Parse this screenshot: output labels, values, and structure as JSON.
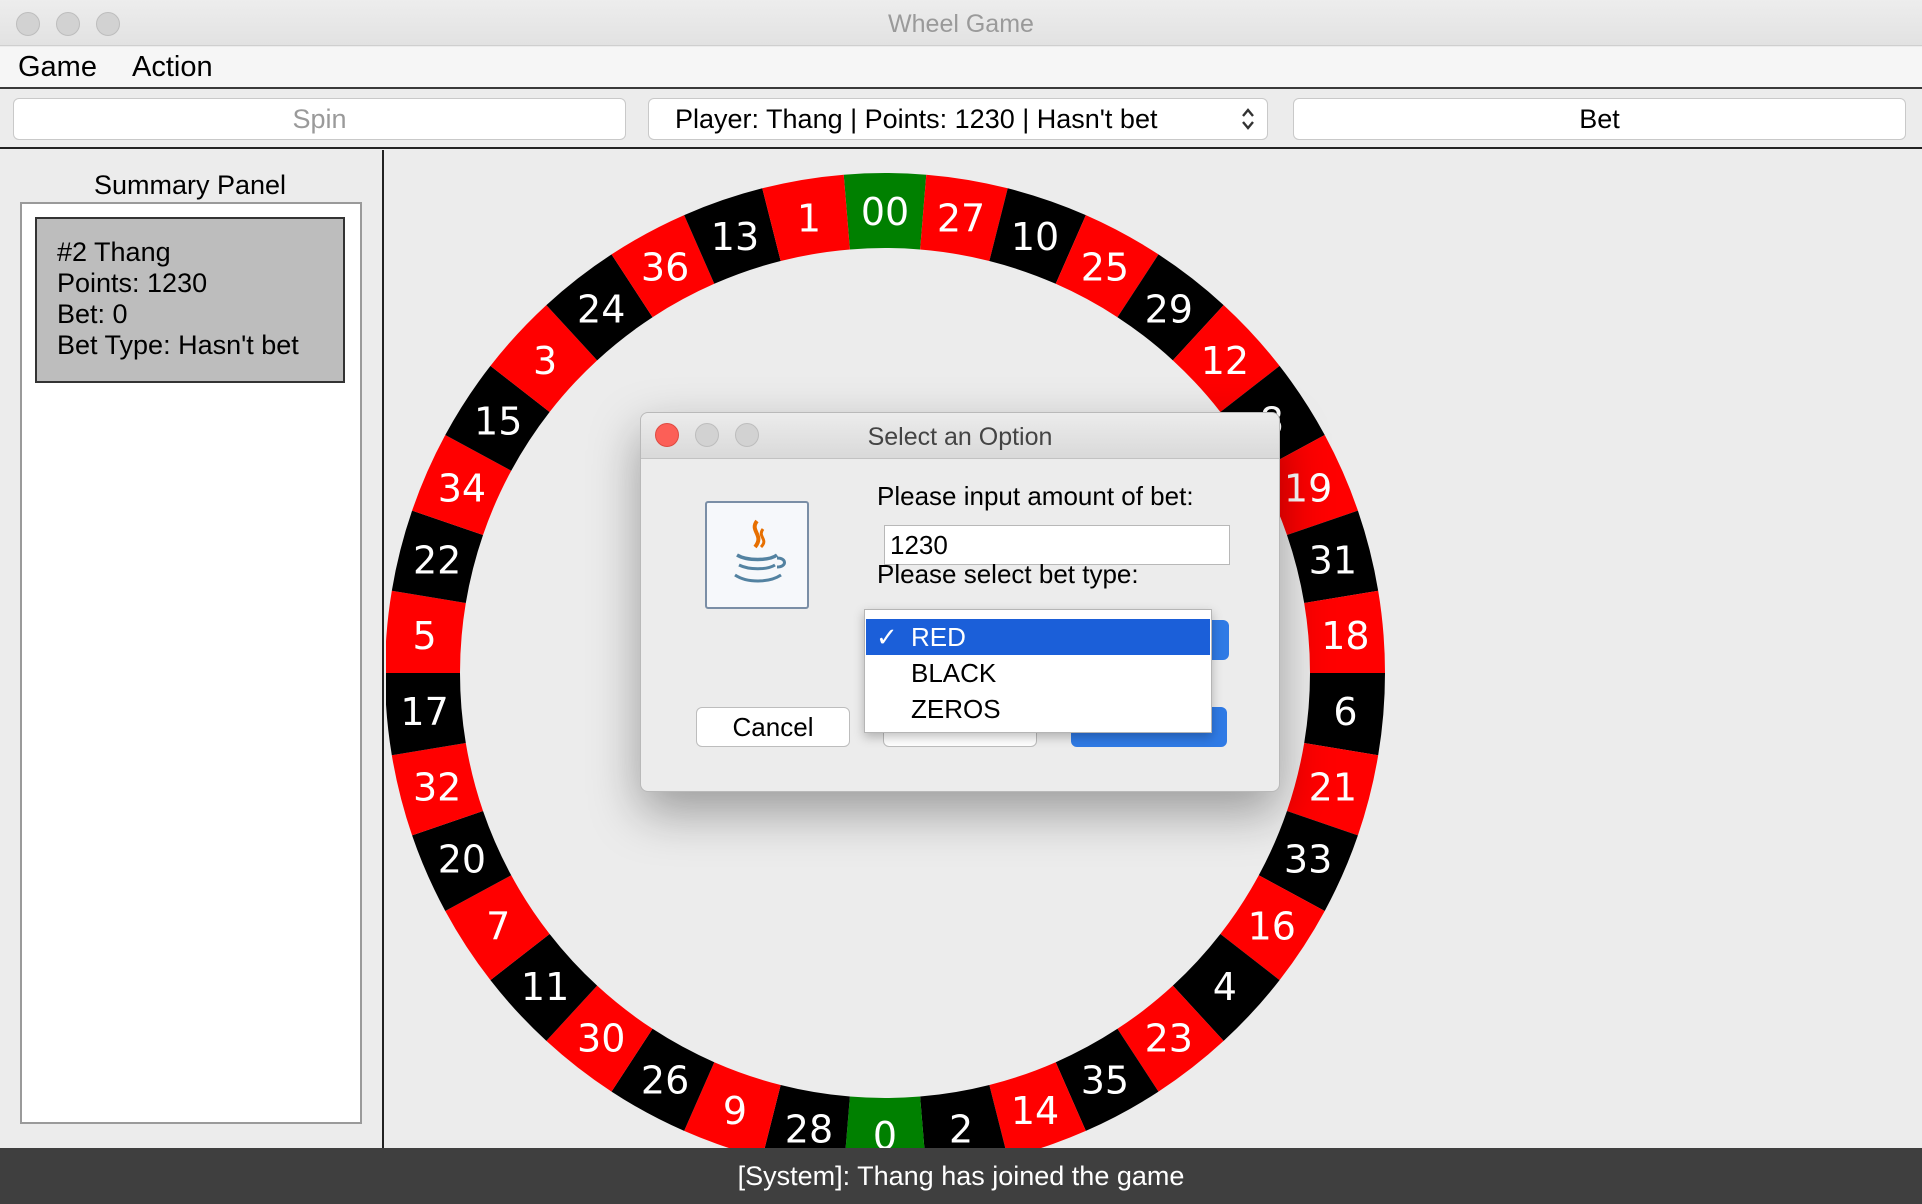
{
  "window": {
    "title": "Wheel Game"
  },
  "menubar": {
    "items": [
      "Game",
      "Action"
    ]
  },
  "toolbar": {
    "spin_label": "Spin",
    "player_select_value": "Player: Thang | Points: 1230 | Hasn't bet",
    "bet_label": "Bet"
  },
  "summary": {
    "title": "Summary Panel",
    "card": {
      "name": "#2 Thang",
      "points": "Points: 1230",
      "bet": "Bet: 0",
      "bet_type": "Bet Type: Hasn't bet"
    }
  },
  "wheel": {
    "numbers": [
      "00",
      "27",
      "10",
      "25",
      "29",
      "12",
      "8",
      "19",
      "31",
      "18",
      "6",
      "21",
      "33",
      "16",
      "4",
      "23",
      "35",
      "14",
      "2",
      "0",
      "28",
      "9",
      "26",
      "30",
      "11",
      "7",
      "20",
      "32",
      "17",
      "5",
      "22",
      "34",
      "15",
      "3",
      "24",
      "36",
      "13",
      "1"
    ],
    "colors": {
      "red": "#ff0000",
      "black": "#000000",
      "green": "#008000"
    },
    "color_pattern": [
      "green",
      "red",
      "black",
      "red",
      "black",
      "red",
      "black",
      "red",
      "black",
      "red",
      "black",
      "red",
      "black",
      "red",
      "black",
      "red",
      "black",
      "red",
      "black",
      "green",
      "black",
      "red",
      "black",
      "red",
      "black",
      "red",
      "black",
      "red",
      "black",
      "red",
      "black",
      "red",
      "black",
      "red",
      "black",
      "red",
      "black",
      "red"
    ]
  },
  "dialog": {
    "title": "Select an Option",
    "amount_label": "Please input amount of bet:",
    "amount_value": "1230",
    "type_label": "Please select bet type:",
    "cancel_label": "Cancel",
    "options": [
      "RED",
      "BLACK",
      "ZEROS"
    ],
    "selected_option": "RED",
    "check_mark": "✓"
  },
  "status": {
    "message": "[System]: Thang has joined the game"
  }
}
